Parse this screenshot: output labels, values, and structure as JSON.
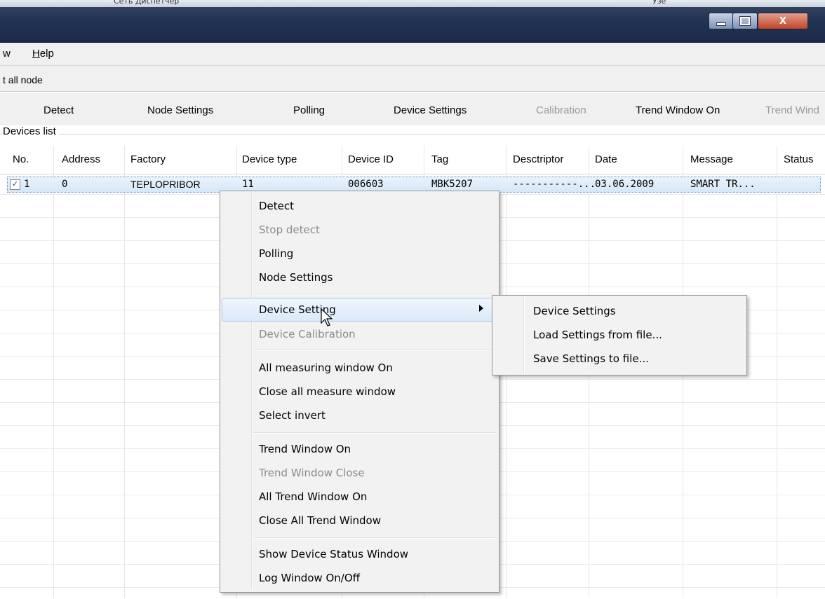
{
  "titlebar": {
    "strip_left": "Сеть   Диспетчер",
    "strip_right": "Узе"
  },
  "menubar": {
    "items": [
      {
        "label": "w"
      },
      {
        "label": "Help",
        "mnemonic": "H"
      }
    ]
  },
  "toolbar1": {
    "label": "t all node"
  },
  "toolbar2": {
    "buttons": [
      {
        "label": "Detect",
        "enabled": true
      },
      {
        "label": "Node Settings",
        "enabled": true
      },
      {
        "label": "Polling",
        "enabled": true
      },
      {
        "label": "Device Settings",
        "enabled": true
      },
      {
        "label": "Calibration",
        "enabled": false
      },
      {
        "label": "Trend Window On",
        "enabled": true
      },
      {
        "label": "Trend Wind",
        "enabled": false
      }
    ]
  },
  "devices_group": {
    "title": "Devices list",
    "columns": [
      "No.",
      "Address",
      "Factory",
      "Device type",
      "Device ID",
      "Tag",
      "Desctriptor",
      "Date",
      "Message",
      "Status"
    ],
    "rows": [
      {
        "checked": true,
        "no": "1",
        "address": "0",
        "factory": "TEPLOPRIBOR",
        "device_type": "11",
        "device_id": "006603",
        "tag": "MBK5207",
        "descriptor": "-----------...",
        "date": "03.06.2009",
        "message": "SMART TR...",
        "status": ""
      }
    ]
  },
  "context_menu": {
    "items": [
      {
        "label": "Detect",
        "enabled": true
      },
      {
        "label": "Stop detect",
        "enabled": false
      },
      {
        "label": "Polling",
        "enabled": true
      },
      {
        "label": "Node Settings",
        "enabled": true
      },
      {
        "label": "Device Setting",
        "enabled": true,
        "has_submenu": true,
        "highlighted": true
      },
      {
        "label": "Device Calibration",
        "enabled": false
      },
      {
        "label": "All measuring window On",
        "enabled": true
      },
      {
        "label": "Close all measure window",
        "enabled": true
      },
      {
        "label": "Select invert",
        "enabled": true
      },
      {
        "label": "Trend Window On",
        "enabled": true
      },
      {
        "label": "Trend Window Close",
        "enabled": false
      },
      {
        "label": "All Trend Window On",
        "enabled": true
      },
      {
        "label": "Close All Trend Window",
        "enabled": true
      },
      {
        "label": "Show Device Status Window",
        "enabled": true
      },
      {
        "label": "Log Window On/Off",
        "enabled": true
      }
    ]
  },
  "submenu": {
    "items": [
      {
        "label": "Device Settings"
      },
      {
        "label": "Load Settings from file..."
      },
      {
        "label": "Save Settings to file..."
      }
    ]
  },
  "icons": {
    "minimize": "minimize-icon",
    "maximize": "maximize-icon",
    "close": "close-icon",
    "submenu_arrow": "chevron-right-icon",
    "cursor": "mouse-pointer-icon"
  },
  "colors": {
    "titlebar": "#243454",
    "close_button": "#c2452a",
    "selection": "#d5e7f8",
    "disabled_text": "#8c8c8c"
  }
}
